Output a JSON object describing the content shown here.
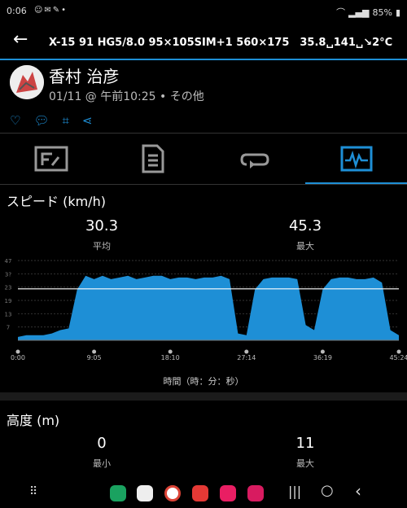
{
  "status": {
    "time": "0:06",
    "battery": "85%"
  },
  "appbar": {
    "title": "X-15 91 HG5/8.0 95×105SIM+1 560×175　35.8␣141␣↘2°C"
  },
  "header": {
    "user_name": "香村 治彦",
    "meta": "01/11 @ 午前10:25 • その他"
  },
  "speed": {
    "title": "スピード (km/h)",
    "avg_value": "30.3",
    "avg_label": "平均",
    "max_value": "45.3",
    "max_label": "最大",
    "x_axis_label": "時間（時：分：秒）"
  },
  "chart_data": {
    "type": "area",
    "xlabel": "時間（時：分：秒）",
    "ylabel": "",
    "x_ticks": [
      "0:00",
      "9:05",
      "18:10",
      "27:14",
      "36:19",
      "45:24"
    ],
    "y_ticks": [
      "7",
      "13",
      "19",
      "23",
      "3?",
      "47"
    ],
    "ylim": [
      0,
      47
    ],
    "average_line": 30.3,
    "series": [
      {
        "x": [
          0,
          1,
          2,
          3,
          4,
          5,
          6,
          7,
          8,
          9,
          10,
          11,
          12,
          13,
          14,
          15,
          16,
          17,
          18,
          19,
          20,
          21,
          22,
          23,
          24,
          25,
          26,
          27,
          28,
          29,
          30,
          31,
          32,
          33,
          34,
          35,
          36,
          37,
          38,
          39,
          40,
          41,
          42,
          43,
          44,
          45
        ],
        "values": [
          2,
          3,
          3,
          3,
          4,
          6,
          7,
          30,
          38,
          36,
          38,
          36,
          37,
          38,
          36,
          37,
          38,
          38,
          36,
          37,
          37,
          36,
          37,
          37,
          38,
          36,
          4,
          3,
          30,
          36,
          37,
          37,
          37,
          36,
          9,
          6,
          30,
          36,
          37,
          37,
          36,
          36,
          37,
          34,
          6,
          3
        ]
      }
    ]
  },
  "altitude": {
    "title": "高度 (m)",
    "min_value": "0",
    "min_label": "最小",
    "max_value": "11",
    "max_label": "最大"
  }
}
